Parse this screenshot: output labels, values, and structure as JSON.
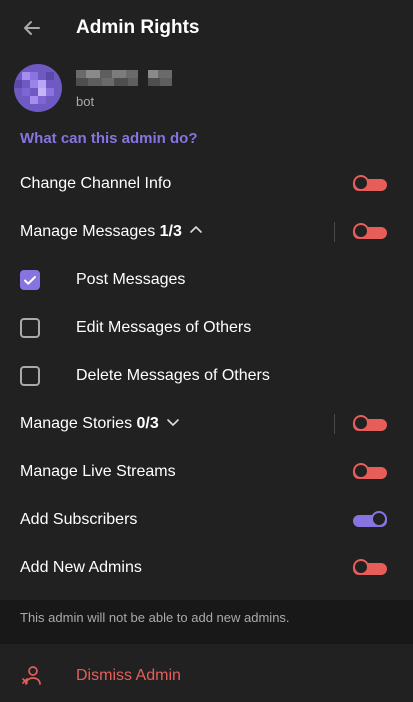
{
  "header": {
    "title": "Admin Rights",
    "back_icon": "arrow-left-icon"
  },
  "profile": {
    "subtitle": "bot",
    "avatar_colors": [
      "#8a6fd6",
      "#5b4aa8",
      "#b09cf0"
    ]
  },
  "section_title": "What can this admin do?",
  "rights": [
    {
      "label": "Change Channel Info",
      "count": "",
      "enabled": false,
      "expandable": false
    },
    {
      "label": "Manage Messages",
      "count": "1/3",
      "enabled": false,
      "expandable": true,
      "expanded": true
    },
    {
      "label": "Manage Stories",
      "count": "0/3",
      "enabled": false,
      "expandable": true,
      "expanded": false
    },
    {
      "label": "Manage Live Streams",
      "count": "",
      "enabled": false,
      "expandable": false
    },
    {
      "label": "Add Subscribers",
      "count": "",
      "enabled": true,
      "expandable": false
    },
    {
      "label": "Add New Admins",
      "count": "",
      "enabled": false,
      "expandable": false
    }
  ],
  "message_permissions": [
    {
      "label": "Post Messages",
      "checked": true
    },
    {
      "label": "Edit Messages of Others",
      "checked": false
    },
    {
      "label": "Delete Messages of Others",
      "checked": false
    }
  ],
  "footer_note": "This admin will not be able to add new admins.",
  "dismiss_label": "Dismiss Admin",
  "colors": {
    "accent": "#8774e1",
    "danger": "#e65e5a",
    "background": "#212121"
  }
}
